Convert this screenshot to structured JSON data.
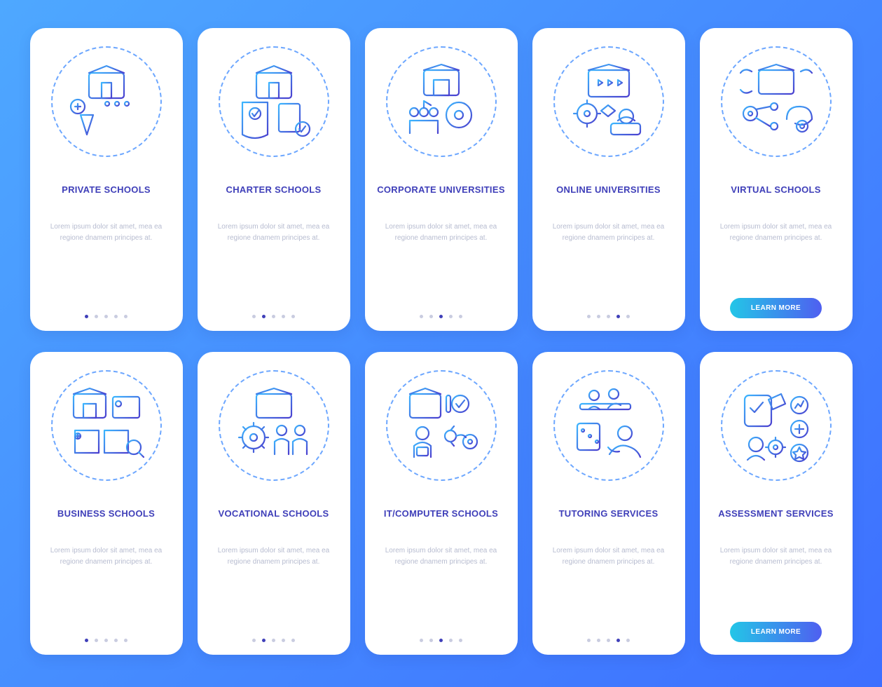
{
  "placeholder_desc": "Lorem ipsum dolor sit amet, mea ea regione dnamem principes at.",
  "learn_more": "LEARN MORE",
  "cards": [
    {
      "title": "PRIVATE SCHOOLS",
      "dots_total": 5,
      "active": 0,
      "button": false,
      "icon": "private"
    },
    {
      "title": "CHARTER SCHOOLS",
      "dots_total": 5,
      "active": 1,
      "button": false,
      "icon": "charter"
    },
    {
      "title": "CORPORATE UNIVERSITIES",
      "dots_total": 5,
      "active": 2,
      "button": false,
      "icon": "corporate"
    },
    {
      "title": "ONLINE UNIVERSITIES",
      "dots_total": 5,
      "active": 3,
      "button": false,
      "icon": "online"
    },
    {
      "title": "VIRTUAL SCHOOLS",
      "dots_total": 5,
      "active": 4,
      "button": true,
      "icon": "virtual"
    },
    {
      "title": "BUSINESS SCHOOLS",
      "dots_total": 5,
      "active": 0,
      "button": false,
      "icon": "business"
    },
    {
      "title": "VOCATIONAL SCHOOLS",
      "dots_total": 5,
      "active": 1,
      "button": false,
      "icon": "vocational"
    },
    {
      "title": "IT/COMPUTER SCHOOLS",
      "dots_total": 5,
      "active": 2,
      "button": false,
      "icon": "it"
    },
    {
      "title": "TUTORING SERVICES",
      "dots_total": 5,
      "active": 3,
      "button": false,
      "icon": "tutoring"
    },
    {
      "title": "ASSESSMENT SERVICES",
      "dots_total": 5,
      "active": 4,
      "button": true,
      "icon": "assessment"
    }
  ]
}
